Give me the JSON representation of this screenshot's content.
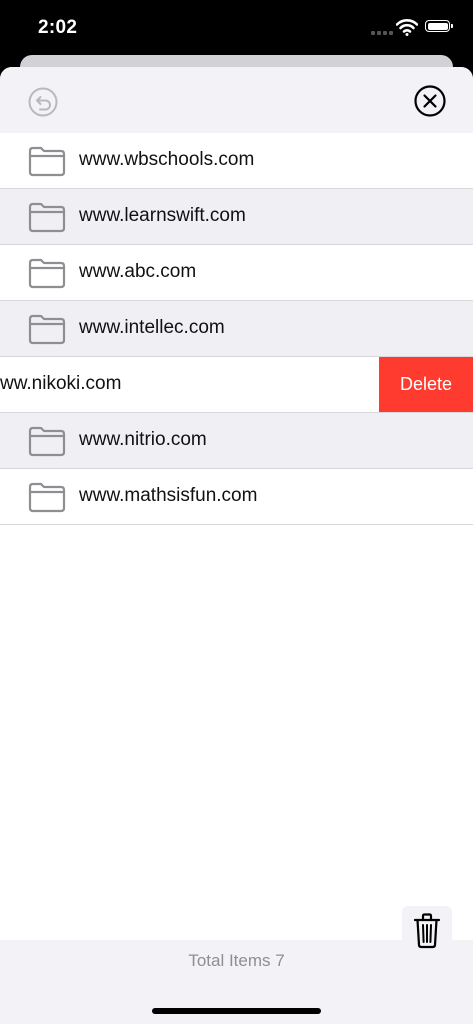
{
  "status_bar": {
    "time": "2:02"
  },
  "header": {
    "undo_icon": "undo-circle-icon",
    "close_icon": "close-circle-icon"
  },
  "rows": [
    {
      "label": "www.wbschools.com",
      "icon": "folder-icon"
    },
    {
      "label": "www.learnswift.com",
      "icon": "folder-icon"
    },
    {
      "label": "www.abc.com",
      "icon": "folder-icon"
    },
    {
      "label": "www.intellec.com",
      "icon": "folder-icon"
    },
    {
      "label": "ww.nikoki.com",
      "delete_label": "Delete"
    },
    {
      "label": "www.nitrio.com",
      "icon": "folder-icon"
    },
    {
      "label": "www.mathsisfun.com",
      "icon": "folder-icon"
    }
  ],
  "footer": {
    "total_label": "Total Items 7"
  },
  "colors": {
    "delete": "#ff3b30",
    "header_bg": "#f2f2f7",
    "alt_row": "#efeff4",
    "footer_text": "#8e8e93"
  }
}
